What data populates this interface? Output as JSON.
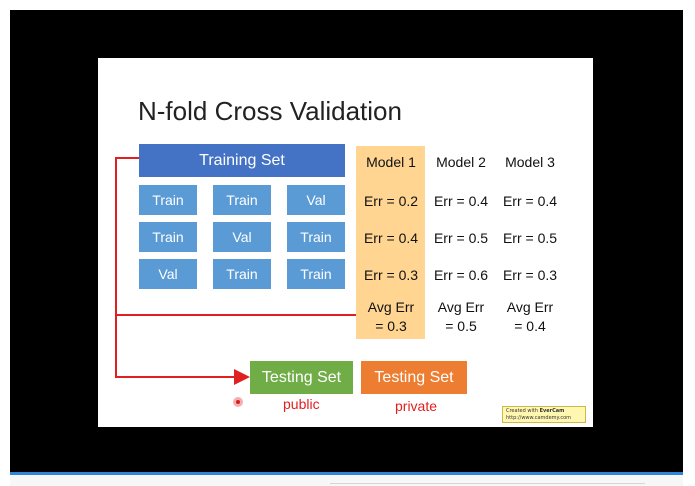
{
  "slide": {
    "title": "N-fold Cross Validation",
    "training_set_label": "Training Set",
    "folds": [
      [
        "Train",
        "Train",
        "Val"
      ],
      [
        "Train",
        "Val",
        "Train"
      ],
      [
        "Val",
        "Train",
        "Train"
      ]
    ],
    "models": [
      {
        "name": "Model 1",
        "errors": [
          "Err = 0.2",
          "Err = 0.4",
          "Err = 0.3"
        ],
        "avg_line1": "Avg Err",
        "avg_line2": "= 0.3"
      },
      {
        "name": "Model 2",
        "errors": [
          "Err = 0.4",
          "Err = 0.5",
          "Err = 0.6"
        ],
        "avg_line1": "Avg Err",
        "avg_line2": "= 0.5"
      },
      {
        "name": "Model 3",
        "errors": [
          "Err = 0.4",
          "Err = 0.5",
          "Err = 0.3"
        ],
        "avg_line1": "Avg Err",
        "avg_line2": "= 0.4"
      }
    ],
    "testing_public_label": "Testing Set",
    "testing_private_label": "Testing Set",
    "public_label": "public",
    "private_label": "private",
    "watermark": {
      "created_with": "Created with",
      "brand": "EverCam",
      "url": "http://www.camdemy.com"
    }
  },
  "colors": {
    "training_set": "#4472c4",
    "fold_box": "#5b9bd5",
    "highlight": "#ffd591",
    "testing_public": "#70ad47",
    "testing_private": "#ed7d31",
    "arrow": "#e02020",
    "progress": "#2f86d8"
  },
  "icons": {
    "cursor": "red-cursor-dot-icon"
  }
}
